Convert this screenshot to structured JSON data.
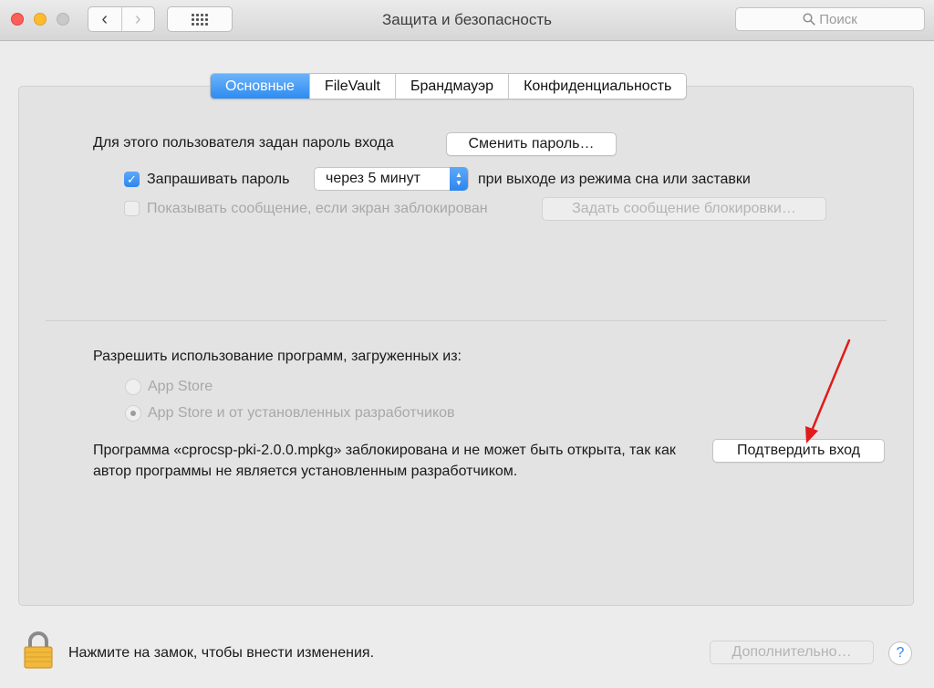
{
  "window": {
    "title": "Защита и безопасность"
  },
  "toolbar": {
    "back_icon": "‹",
    "forward_icon": "›",
    "search_placeholder": "Поиск"
  },
  "tabs": [
    {
      "label": "Основные",
      "active": true
    },
    {
      "label": "FileVault",
      "active": false
    },
    {
      "label": "Брандмауэр",
      "active": false
    },
    {
      "label": "Конфиденциальность",
      "active": false
    }
  ],
  "general": {
    "password_set_label": "Для этого пользователя задан пароль входа",
    "change_password_button": "Сменить пароль…",
    "require_password_label": "Запрашивать пароль",
    "require_password_checked": true,
    "require_password_delay": "через 5 минут",
    "after_sleep_label": "при выходе из режима сна или заставки",
    "show_message_label": "Показывать сообщение, если экран заблокирован",
    "show_message_checked": false,
    "set_lock_message_button": "Задать сообщение блокировки…"
  },
  "apps": {
    "allow_label": "Разрешить использование программ, загруженных из:",
    "options": [
      {
        "label": "App Store",
        "selected": false
      },
      {
        "label": "App Store и от установленных разработчиков",
        "selected": true
      }
    ],
    "blocked_message": "Программа «cprocsp-pki-2.0.0.mpkg» заблокирована и не может быть открыта, так как автор программы не является установленным разработчиком.",
    "confirm_button": "Подтвердить вход"
  },
  "footer": {
    "lock_text": "Нажмите на замок, чтобы внести изменения.",
    "advanced_button": "Дополнительно…",
    "help_label": "?"
  },
  "colors": {
    "accent": "#2c86ee",
    "annotation_arrow": "#e01b1b"
  }
}
